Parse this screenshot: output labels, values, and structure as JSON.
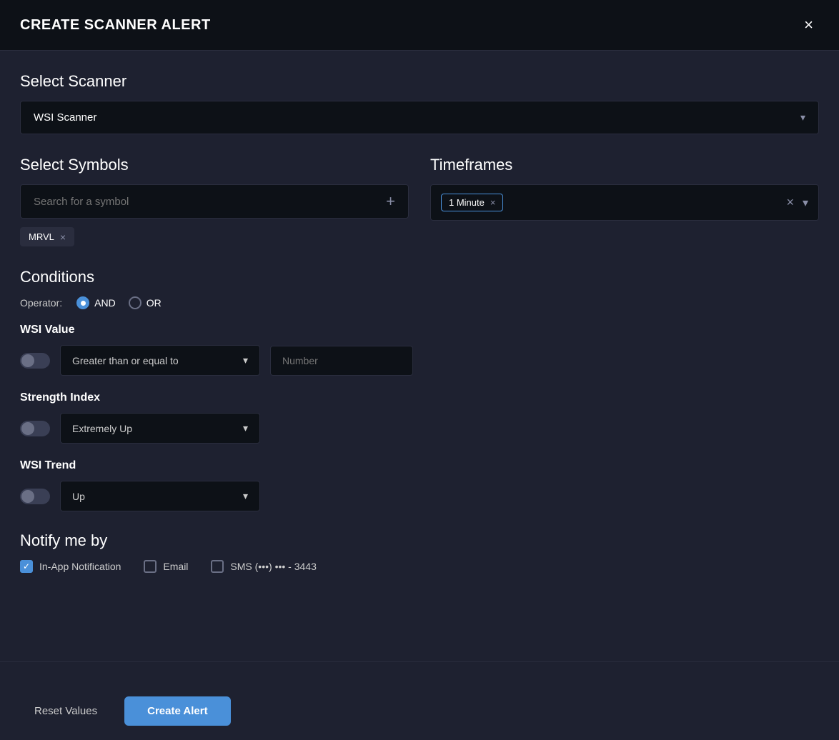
{
  "header": {
    "title": "CREATE SCANNER ALERT",
    "close_label": "×"
  },
  "scanner_section": {
    "label": "Select Scanner",
    "dropdown_value": "WSI Scanner",
    "dropdown_placeholder": "WSI Scanner"
  },
  "symbols_section": {
    "label": "Select Symbols",
    "search_placeholder": "Search for a symbol",
    "tags": [
      {
        "label": "MRVL"
      }
    ]
  },
  "timeframes_section": {
    "label": "Timeframes",
    "tags": [
      {
        "label": "1 Minute"
      }
    ]
  },
  "conditions_section": {
    "label": "Conditions",
    "operator_label": "Operator:",
    "operators": [
      {
        "label": "AND",
        "selected": true
      },
      {
        "label": "OR",
        "selected": false
      }
    ],
    "blocks": [
      {
        "label": "WSI Value",
        "enabled": false,
        "dropdown_value": "Greater than or equal to",
        "number_placeholder": "Number"
      },
      {
        "label": "Strength Index",
        "enabled": false,
        "dropdown_value": "Extremely Up"
      },
      {
        "label": "WSI Trend",
        "enabled": false,
        "dropdown_value": "Up"
      }
    ]
  },
  "notify_section": {
    "label": "Notify me by",
    "options": [
      {
        "label": "In-App Notification",
        "checked": true
      },
      {
        "label": "Email",
        "checked": false
      },
      {
        "label": "SMS (•••) ••• - 3443",
        "checked": false
      }
    ]
  },
  "footer": {
    "reset_label": "Reset Values",
    "create_label": "Create Alert"
  }
}
